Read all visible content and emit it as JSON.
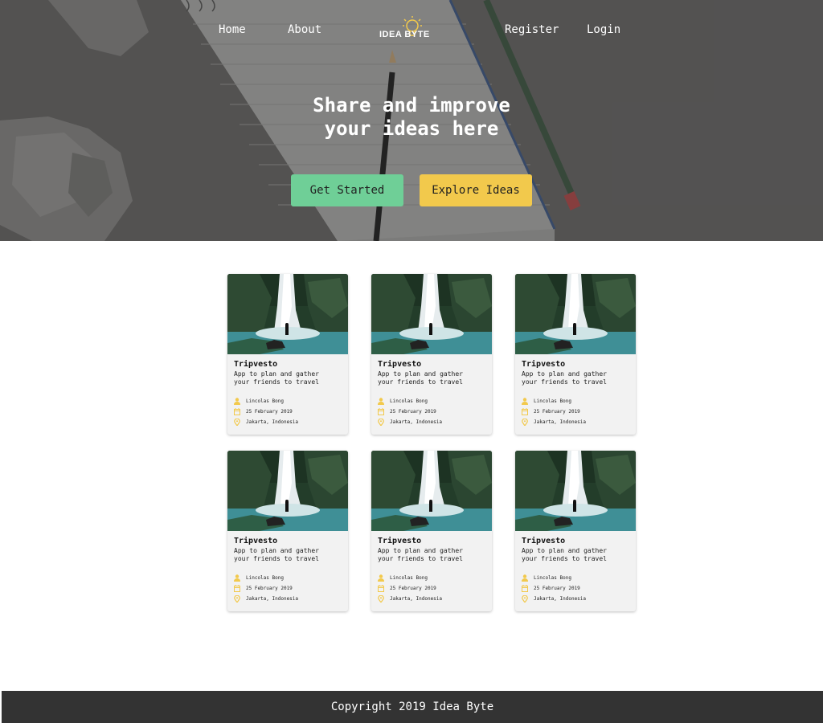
{
  "nav": {
    "home": "Home",
    "about": "About",
    "logo_text": "IDEA BYTE",
    "register": "Register",
    "login": "Login"
  },
  "hero": {
    "title_line1": "Share and improve",
    "title_line2": "your ideas here",
    "get_started": "Get Started",
    "explore": "Explore Ideas"
  },
  "colors": {
    "green": "#6fcf97",
    "yellow": "#f2c94c",
    "footer": "#333333"
  },
  "cards": [
    {
      "title": "Tripvesto",
      "desc_line1": "App to plan and gather",
      "desc_line2": "your friends to travel",
      "author": "Lincolas Bong",
      "date": "25 February 2019",
      "location": "Jakarta, Indonesia"
    },
    {
      "title": "Tripvesto",
      "desc_line1": "App to plan and gather",
      "desc_line2": "your friends to travel",
      "author": "Lincolas Bong",
      "date": "25 February 2019",
      "location": "Jakarta, Indonesia"
    },
    {
      "title": "Tripvesto",
      "desc_line1": "App to plan and gather",
      "desc_line2": "your friends to travel",
      "author": "Lincolas Bong",
      "date": "25 February 2019",
      "location": "Jakarta, Indonesia"
    },
    {
      "title": "Tripvesto",
      "desc_line1": "App to plan and gather",
      "desc_line2": "your friends to travel",
      "author": "Lincolas Bong",
      "date": "25 February 2019",
      "location": "Jakarta, Indonesia"
    },
    {
      "title": "Tripvesto",
      "desc_line1": "App to plan and gather",
      "desc_line2": "your friends to travel",
      "author": "Lincolas Bong",
      "date": "25 February 2019",
      "location": "Jakarta, Indonesia"
    },
    {
      "title": "Tripvesto",
      "desc_line1": "App to plan and gather",
      "desc_line2": "your friends to travel",
      "author": "Lincolas Bong",
      "date": "25 February 2019",
      "location": "Jakarta, Indonesia"
    }
  ],
  "footer": {
    "copyright": "Copyright 2019 Idea Byte"
  }
}
